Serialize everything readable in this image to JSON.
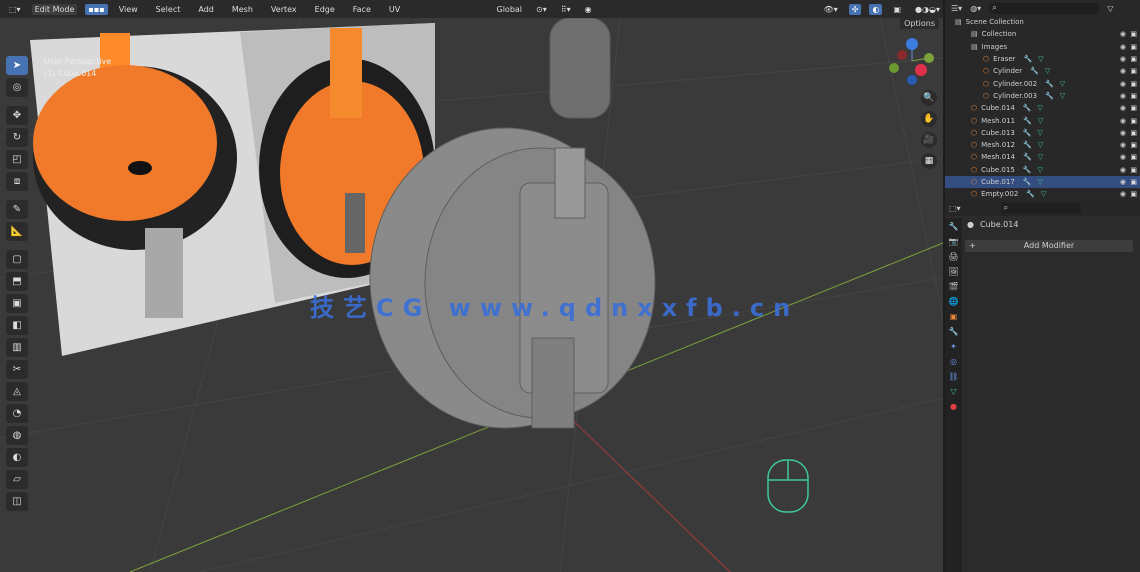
{
  "header": {
    "mode": "Edit Mode",
    "menus": [
      "View",
      "Select",
      "Add",
      "Mesh",
      "Vertex",
      "Edge",
      "Face",
      "UV"
    ],
    "orientation": "Global",
    "options_label": "Options"
  },
  "viewport": {
    "view_name": "User Perspective",
    "object_label": "(1) Cube.014",
    "watermark": "技艺CG www.qdnxxfb.cn",
    "axis_colors": {
      "x": "#c23c3c",
      "y": "#7ca33a",
      "z": "#3b7ce0"
    }
  },
  "toolbar": {
    "tools": [
      "select-box",
      "cursor",
      "move",
      "rotate",
      "scale",
      "transform",
      "annotate",
      "measure",
      "add-cube",
      "extrude",
      "inset",
      "bevel",
      "loop-cut",
      "knife",
      "poly-build",
      "spin",
      "smooth",
      "shrink",
      "shear",
      "rip"
    ]
  },
  "outliner": {
    "root": "Scene Collection",
    "rows": [
      {
        "name": "Collection",
        "level": 1
      },
      {
        "name": "Images",
        "level": 1
      },
      {
        "name": "Eraser",
        "level": 2
      },
      {
        "name": "Cylinder",
        "level": 2
      },
      {
        "name": "Cylinder.002",
        "level": 2
      },
      {
        "name": "Cylinder.003",
        "level": 2
      },
      {
        "name": "Cube.014",
        "level": 1
      },
      {
        "name": "Mesh.011",
        "level": 1
      },
      {
        "name": "Cube.013",
        "level": 1
      },
      {
        "name": "Mesh.012",
        "level": 1
      },
      {
        "name": "Mesh.014",
        "level": 1
      },
      {
        "name": "Cube.015",
        "level": 1
      },
      {
        "name": "Cube.017",
        "level": 1,
        "selected": true
      },
      {
        "name": "Empty.002",
        "level": 1
      }
    ]
  },
  "properties": {
    "object_name": "Cube.014",
    "add_modifier": "Add Modifier"
  }
}
